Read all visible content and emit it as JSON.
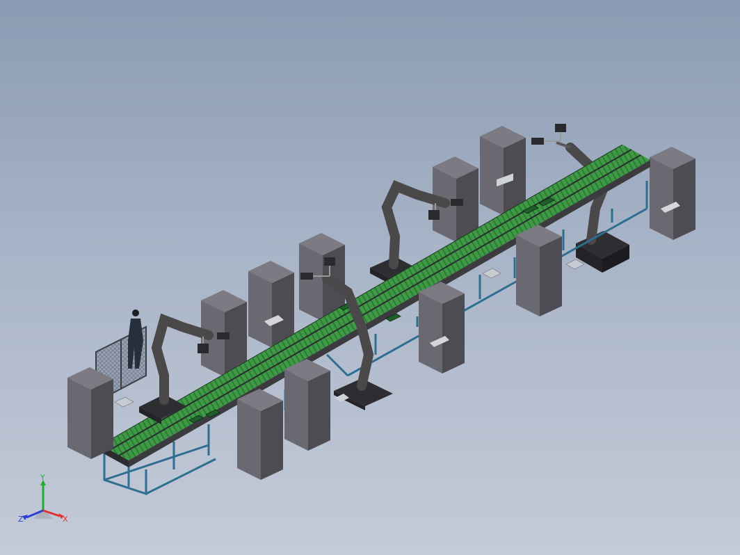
{
  "viewport": {
    "background_top": "#8a9bb3",
    "background_bottom": "#c4cbd8"
  },
  "scene": {
    "conveyor_color": "#3f9a45",
    "frame_color": "#2e6f91",
    "cabinet_color": "#55525a",
    "robot_color": "#4a4849"
  },
  "triad": {
    "x_label": "X",
    "y_label": "Y",
    "z_label": "Z",
    "x_color": "#e03030",
    "y_color": "#22aa33",
    "z_color": "#2a3fd6"
  }
}
